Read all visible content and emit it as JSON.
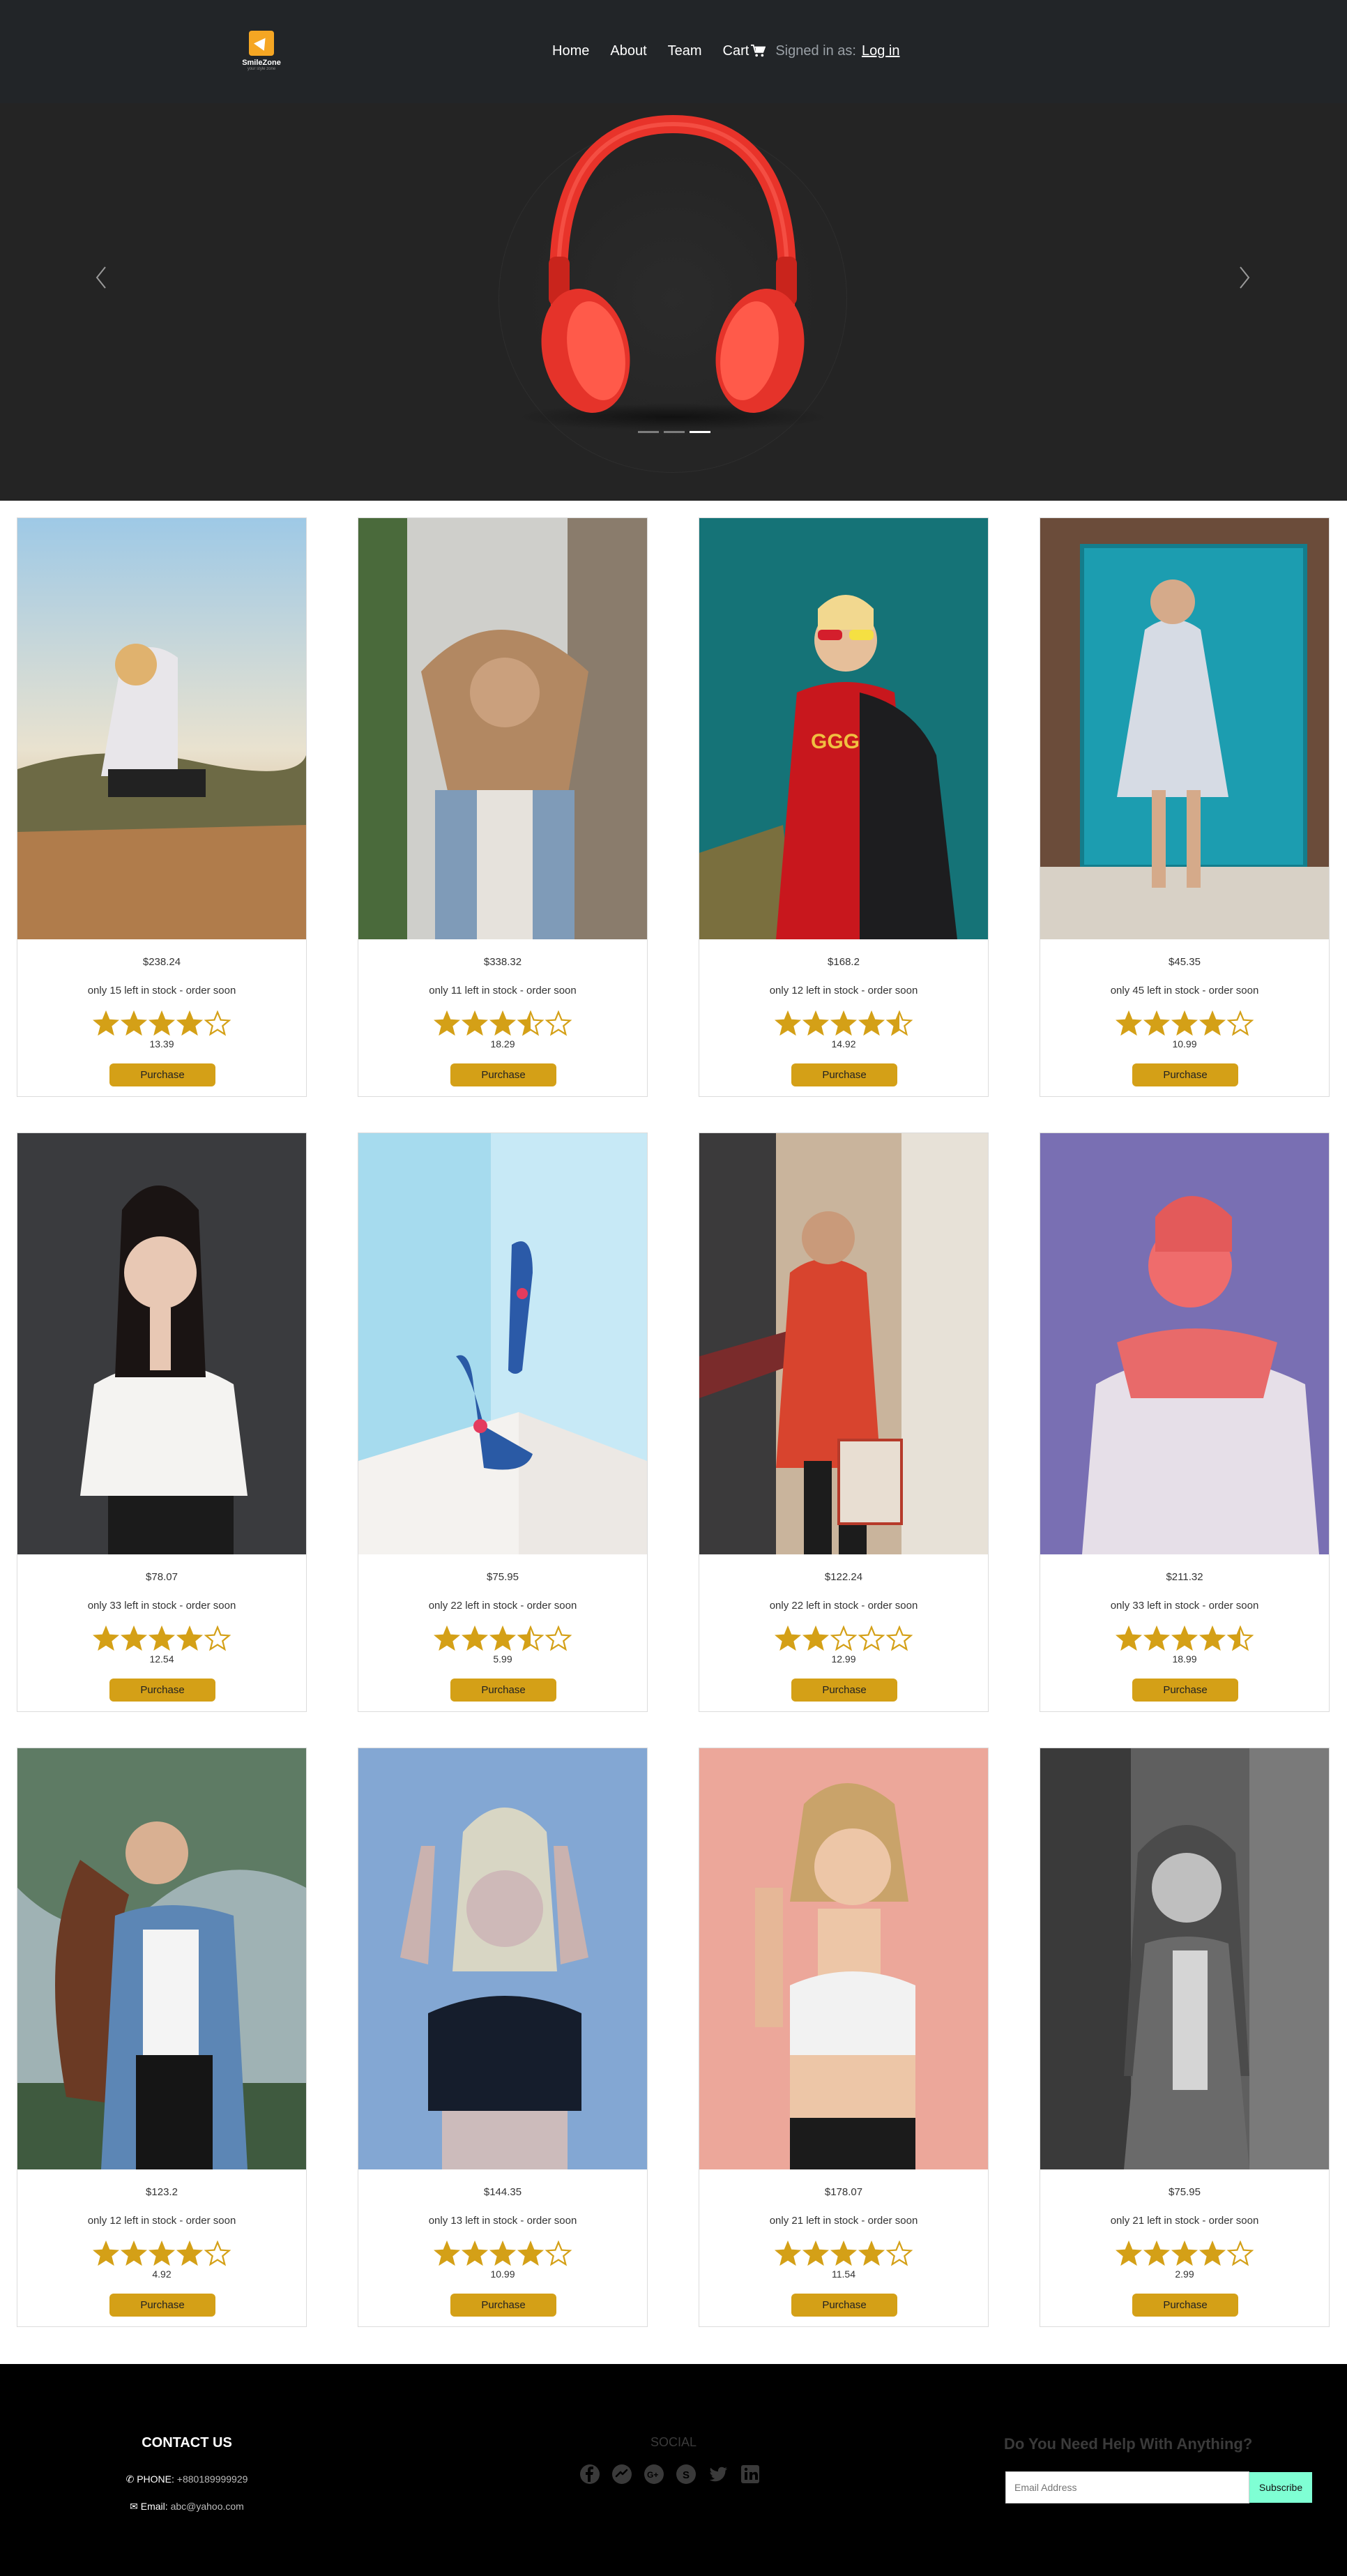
{
  "brand": {
    "name": "SmileZone",
    "tagline": "your style zone"
  },
  "nav": {
    "home": "Home",
    "about": "About",
    "team": "Team",
    "cart": "Cart",
    "signed_in_as": "Signed in as:",
    "login": "Log in"
  },
  "hero": {
    "indicators": 3,
    "active_indicator": 2
  },
  "products": [
    {
      "price": "$238.24",
      "stock": "only 15 left in stock - order soon",
      "stars": 4,
      "rating": "13.39",
      "button": "Purchase"
    },
    {
      "price": "$338.32",
      "stock": "only 11 left in stock - order soon",
      "stars": 3.5,
      "rating": "18.29",
      "button": "Purchase"
    },
    {
      "price": "$168.2",
      "stock": "only 12 left in stock - order soon",
      "stars": 4.5,
      "rating": "14.92",
      "button": "Purchase"
    },
    {
      "price": "$45.35",
      "stock": "only 45 left in stock - order soon",
      "stars": 4,
      "rating": "10.99",
      "button": "Purchase"
    },
    {
      "price": "$78.07",
      "stock": "only 33 left in stock - order soon",
      "stars": 4,
      "rating": "12.54",
      "button": "Purchase"
    },
    {
      "price": "$75.95",
      "stock": "only 22 left in stock - order soon",
      "stars": 3.5,
      "rating": "5.99",
      "button": "Purchase"
    },
    {
      "price": "$122.24",
      "stock": "only 22 left in stock - order soon",
      "stars": 2,
      "rating": "12.99",
      "button": "Purchase"
    },
    {
      "price": "$211.32",
      "stock": "only 33 left in stock - order soon",
      "stars": 4.5,
      "rating": "18.99",
      "button": "Purchase"
    },
    {
      "price": "$123.2",
      "stock": "only 12 left in stock - order soon",
      "stars": 4,
      "rating": "4.92",
      "button": "Purchase"
    },
    {
      "price": "$144.35",
      "stock": "only 13 left in stock - order soon",
      "stars": 4,
      "rating": "10.99",
      "button": "Purchase"
    },
    {
      "price": "$178.07",
      "stock": "only 21 left in stock - order soon",
      "stars": 4,
      "rating": "11.54",
      "button": "Purchase"
    },
    {
      "price": "$75.95",
      "stock": "only 21 left in stock - order soon",
      "stars": 4,
      "rating": "2.99",
      "button": "Purchase"
    }
  ],
  "footer": {
    "contact_title": "CONTACT US",
    "phone_label": "PHONE:",
    "phone": "+880189999929",
    "email_label": "Email:",
    "email": "abc@yahoo.com",
    "social_title": "SOCIAL",
    "social_icons": [
      "facebook-icon",
      "messenger-icon",
      "google-plus-icon",
      "skype-icon",
      "twitter-icon",
      "linkedin-icon"
    ],
    "help_title": "Do You Need Help With Anything?",
    "email_placeholder": "Email Address",
    "subscribe": "Subscribe"
  },
  "colors": {
    "navbar": "#222528",
    "hero": "#242424",
    "star": "#d4a017",
    "button": "#d4a017",
    "footer": "#000000",
    "subscribe": "#7fffd4"
  }
}
